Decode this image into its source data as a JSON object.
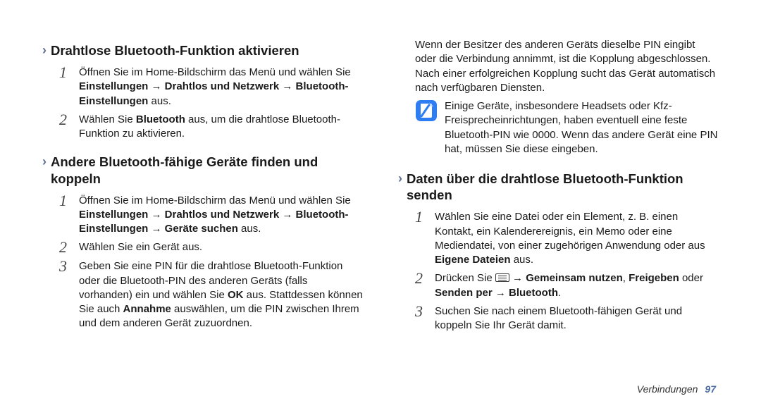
{
  "left": {
    "section1": {
      "title": "Drahtlose Bluetooth-Funktion aktivieren",
      "step1a": "Öffnen Sie im Home-Bildschirm das Menü und wählen Sie ",
      "step1b": "Einstellungen → Drahtlos und Netzwerk → Bluetooth-Einstellungen",
      "step1c": " aus.",
      "step2a": "Wählen Sie ",
      "step2b": "Bluetooth",
      "step2c": " aus, um die drahtlose Bluetooth-Funktion zu aktivieren."
    },
    "section2": {
      "title": "Andere Bluetooth-fähige Geräte finden und koppeln",
      "step1a": "Öffnen Sie im Home-Bildschirm das Menü und wählen Sie ",
      "step1b": "Einstellungen → Drahtlos und Netzwerk → Bluetooth-Einstellungen → Geräte suchen",
      "step1c": " aus.",
      "step2": "Wählen Sie ein Gerät aus.",
      "step3a": "Geben Sie eine PIN für die drahtlose Bluetooth-Funktion oder die Bluetooth-PIN des anderen Geräts (falls vorhanden) ein und wählen Sie ",
      "step3b": "OK",
      "step3c": " aus. Stattdessen können Sie auch ",
      "step3d": "Annahme",
      "step3e": " auswählen, um die PIN zwischen Ihrem und dem anderen Gerät zuzuordnen."
    }
  },
  "right": {
    "continuation": "Wenn der Besitzer des anderen Geräts dieselbe PIN eingibt oder die Verbindung annimmt, ist die Kopplung abgeschlossen. Nach einer erfolgreichen Kopplung sucht das Gerät automatisch nach verfügbaren Diensten.",
    "note": "Einige Geräte, insbesondere Headsets oder Kfz-Freisprecheinrichtungen, haben eventuell eine feste Bluetooth-PIN wie 0000. Wenn das andere Gerät eine PIN hat, müssen Sie diese eingeben.",
    "section3": {
      "title": "Daten über die drahtlose Bluetooth-Funktion senden",
      "step1a": "Wählen Sie eine Datei oder ein Element, z. B. einen Kontakt, ein Kalenderereignis, ein Memo oder eine Mediendatei, von einer zugehörigen Anwendung oder aus ",
      "step1b": "Eigene Dateien",
      "step1c": " aus.",
      "step2a": "Drücken Sie ",
      "step2b": " → ",
      "step2c": "Gemeinsam nutzen",
      "step2d": ", ",
      "step2e": "Freigeben",
      "step2f": " oder ",
      "step2g": "Senden per → Bluetooth",
      "step2h": ".",
      "step3": "Suchen Sie nach einem Bluetooth-fähigen Gerät und koppeln Sie Ihr Gerät damit."
    }
  },
  "nums": {
    "n1": "1",
    "n2": "2",
    "n3": "3"
  },
  "footer": {
    "label": "Verbindungen",
    "page": "97"
  }
}
